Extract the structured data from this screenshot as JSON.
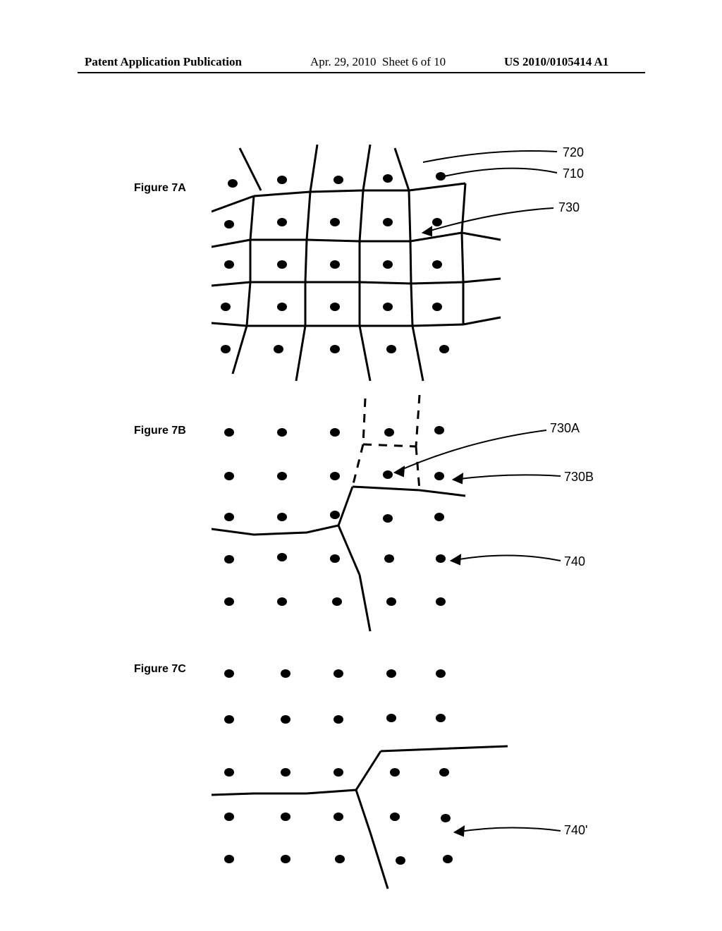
{
  "header": {
    "publication_type": "Patent Application Publication",
    "date": "Apr. 29, 2010",
    "sheet": "Sheet 6 of 10",
    "pub_number": "US 2010/0105414 A1"
  },
  "figures": {
    "a": {
      "label": "Figure 7A",
      "ref_720": "720",
      "ref_710": "710",
      "ref_730": "730"
    },
    "b": {
      "label": "Figure 7B",
      "ref_730A": "730A",
      "ref_730B": "730B",
      "ref_740": "740"
    },
    "c": {
      "label": "Figure 7C",
      "ref_740p": "740'"
    }
  }
}
